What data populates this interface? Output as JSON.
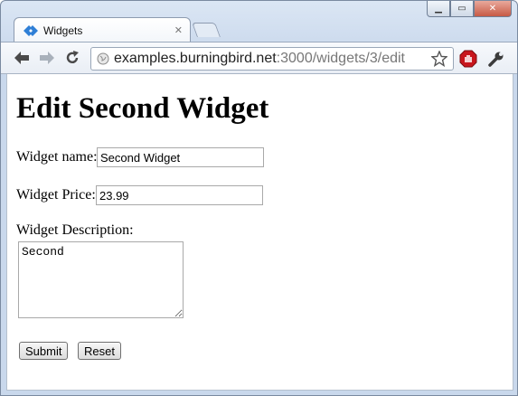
{
  "browser": {
    "tab_title": "Widgets",
    "url_host": "examples.burningbird.net",
    "url_rest": ":3000/widgets/3/edit"
  },
  "page": {
    "heading": "Edit Second Widget",
    "name_label": "Widget name:",
    "name_value": "Second Widget",
    "price_label": "Widget Price:",
    "price_value": "23.99",
    "desc_label": "Widget Description:",
    "desc_value": "Second",
    "submit_label": "Submit",
    "reset_label": "Reset"
  }
}
